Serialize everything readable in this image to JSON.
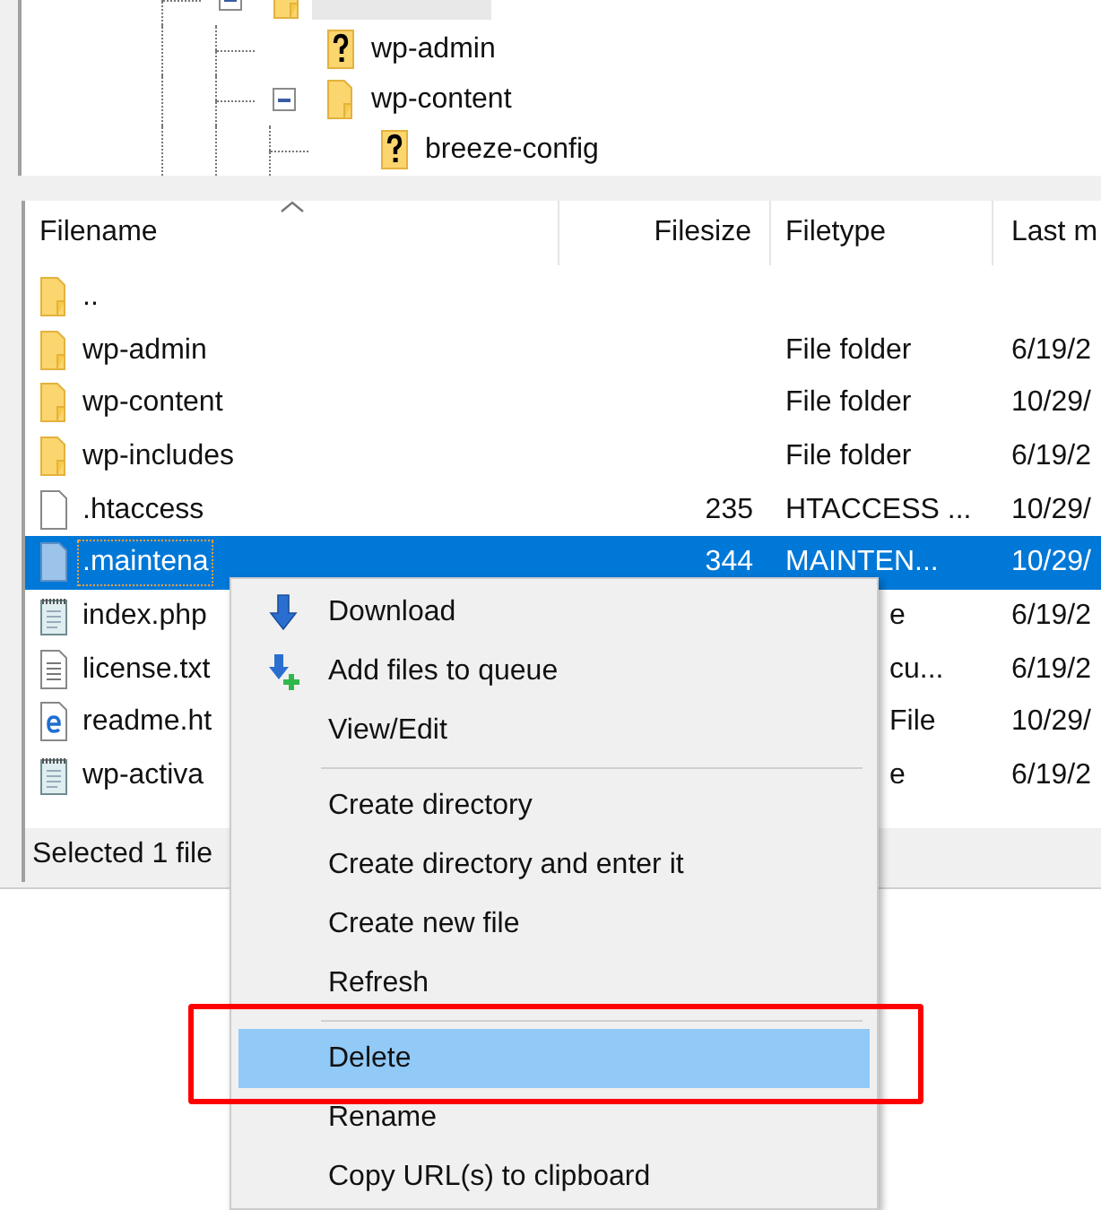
{
  "tree": [
    {
      "kind": "folder",
      "expanded": true,
      "selected": true,
      "children": [
        {
          "label": "wp-admin",
          "kind": "unknown"
        },
        {
          "label": "wp-content",
          "kind": "folder",
          "expanded": true,
          "selected": false,
          "children": [
            {
              "label": "breeze-config",
              "kind": "unknown"
            }
          ]
        }
      ]
    }
  ],
  "table": {
    "columns": [
      "Filename",
      "Filesize",
      "Filetype",
      "Last m"
    ],
    "rows": [
      {
        "kind": "folder",
        "name": "..",
        "selected": false
      },
      {
        "kind": "folder",
        "name": "wp-admin",
        "type": "File folder",
        "date": "6/19/2",
        "selected": false,
        "hidden_by_menu": false
      },
      {
        "kind": "folder",
        "name": "wp-content",
        "type": "File folder",
        "date": "10/29/",
        "selected": false,
        "hidden_by_menu": false
      },
      {
        "kind": "folder",
        "name": "wp-includes",
        "type": "File folder",
        "date": "6/19/2",
        "selected": false,
        "hidden_by_menu": false
      },
      {
        "kind": "file",
        "name": ".htaccess",
        "size": "235",
        "type": "HTACCESS ...",
        "date": "10/29/",
        "selected": false,
        "hidden_by_menu": false
      },
      {
        "kind": "file",
        "name": ".maintena",
        "size": "344",
        "type": "MAINTEN...",
        "date": "10/29/",
        "selected": true,
        "hidden_by_menu": false
      },
      {
        "kind": "script",
        "name": "index.php",
        "type": "e",
        "date": "6/19/2",
        "selected": false,
        "hidden_by_menu": true
      },
      {
        "kind": "text",
        "name": "license.txt",
        "type": "cu...",
        "date": "6/19/2",
        "selected": false,
        "hidden_by_menu": true
      },
      {
        "kind": "web",
        "name": "readme.ht",
        "type": "File",
        "date": "10/29/",
        "selected": false,
        "hidden_by_menu": true
      },
      {
        "kind": "script",
        "name": "wp-activa",
        "type": "e",
        "date": "6/19/2",
        "selected": false,
        "hidden_by_menu": true
      }
    ]
  },
  "status_bar": "Selected 1 file",
  "context_menu": [
    {
      "kind": "download",
      "label": "Download",
      "selected": false
    },
    {
      "kind": "queue",
      "label": "Add files to queue",
      "selected": false
    },
    {
      "kind": "item",
      "label": "View/Edit",
      "selected": false
    },
    {
      "kind": "separator"
    },
    {
      "kind": "item",
      "label": "Create directory",
      "selected": false
    },
    {
      "kind": "item",
      "label": "Create directory and enter it",
      "selected": false
    },
    {
      "kind": "item",
      "label": "Create new file",
      "selected": false
    },
    {
      "kind": "item",
      "label": "Refresh",
      "selected": false
    },
    {
      "kind": "separator"
    },
    {
      "kind": "item",
      "label": "Delete",
      "selected": true
    },
    {
      "kind": "item",
      "label": "Rename",
      "selected": false
    },
    {
      "kind": "item",
      "label": "Copy URL(s) to clipboard",
      "selected": false
    }
  ]
}
